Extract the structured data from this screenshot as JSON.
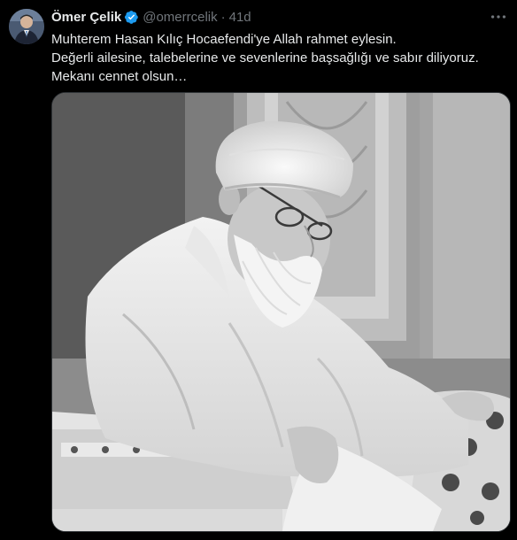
{
  "tweet": {
    "author_name": "Ömer Çelik",
    "handle": "@omerrcelik",
    "separator": "·",
    "time": "41d",
    "text_lines": [
      "Muhterem Hasan Kılıç Hocaefendi'ye Allah rahmet eylesin.",
      "Değerli ailesine, talebelerine ve sevenlerine başsağlığı ve sabır diliyoruz.",
      "Mekanı cennet olsun…"
    ],
    "media_kind": "black-and-white photo",
    "icons": {
      "avatar": "avatar-image",
      "verified": "verified-badge-icon",
      "more": "more-options-icon"
    }
  },
  "colors": {
    "background": "#000000",
    "text": "#e7e9ea",
    "secondary": "#71767b",
    "verified": "#1d9bf0",
    "border": "#2f3336"
  }
}
